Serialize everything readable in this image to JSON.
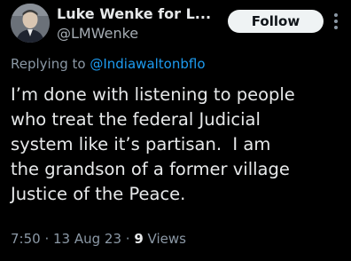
{
  "author": {
    "display_name": "Luke Wenke for L...",
    "handle": "@LMWenke",
    "avatar_icon": "user-avatar"
  },
  "follow_button": {
    "label": "Follow"
  },
  "more_menu_icon": "vertical-ellipsis-icon",
  "reply": {
    "prefix": "Replying to",
    "mention": "@Indiawaltonbflo"
  },
  "tweet": {
    "text": "I’m done with listening to people\nwho treat the federal Judicial\nsystem like it’s partisan.  I am\nthe grandson of a former village\nJustice of the Peace."
  },
  "meta": {
    "time": "7:50",
    "separator": " · ",
    "date": "13 Aug 23",
    "views_count": "9",
    "views_label": "Views"
  },
  "colors": {
    "background": "#000000",
    "text_primary": "#e7e9ea",
    "text_secondary": "#8b98a5",
    "accent": "#1d9bf0",
    "button_bg": "#eff3f4"
  }
}
